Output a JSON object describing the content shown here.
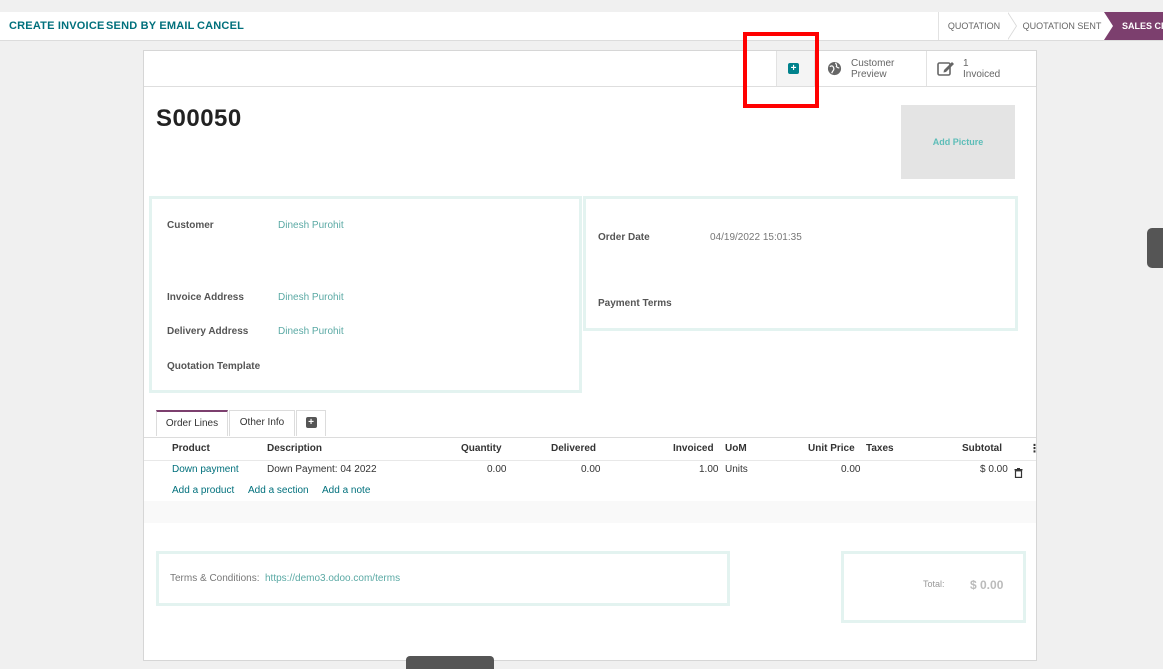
{
  "actions": {
    "create_invoice": "CREATE INVOICE",
    "send_by_email": "SEND BY EMAIL",
    "cancel": "CANCEL"
  },
  "statusbar": {
    "quotation": "QUOTATION",
    "quotation_sent": "QUOTATION SENT",
    "sales_order": "SALES CR"
  },
  "smart_buttons": {
    "customer_preview_line1": "Customer",
    "customer_preview_line2": "Preview",
    "invoiced_count": "1",
    "invoiced_label": "Invoiced"
  },
  "record": {
    "name": "S00050",
    "add_picture": "Add Picture"
  },
  "form_left": {
    "customer_label": "Customer",
    "customer_value": "Dinesh Purohit",
    "invoice_address_label": "Invoice Address",
    "invoice_address_value": "Dinesh Purohit",
    "delivery_address_label": "Delivery Address",
    "delivery_address_value": "Dinesh Purohit",
    "quotation_template_label": "Quotation Template"
  },
  "form_right": {
    "order_date_label": "Order Date",
    "order_date_value": "04/19/2022 15:01:35",
    "payment_terms_label": "Payment Terms"
  },
  "tabs": {
    "order_lines": "Order Lines",
    "other_info": "Other Info"
  },
  "table": {
    "headers": {
      "product": "Product",
      "description": "Description",
      "quantity": "Quantity",
      "delivered": "Delivered",
      "invoiced": "Invoiced",
      "uom": "UoM",
      "unit_price": "Unit Price",
      "taxes": "Taxes",
      "subtotal": "Subtotal"
    },
    "rows": [
      {
        "product": "Down payment",
        "description": "Down Payment: 04 2022",
        "quantity": "0.00",
        "delivered": "0.00",
        "invoiced": "1.00",
        "uom": "Units",
        "unit_price": "0.00",
        "taxes": "",
        "subtotal": "$ 0.00"
      }
    ],
    "add_product": "Add a product",
    "add_section": "Add a section",
    "add_note": "Add a note"
  },
  "footer": {
    "terms_prefix": "Terms & Conditions:",
    "terms_link": "https://demo3.odoo.com/terms",
    "total_label": "Total:",
    "total_value": "$ 0.00"
  },
  "icons": {
    "plus": "+",
    "globe": "globe-icon",
    "edit": "edit-icon",
    "trash": "trash-icon",
    "kebab": "vertical-dots-icon"
  },
  "colors": {
    "accent": "#00707c",
    "link": "#5aa9a4",
    "status_active": "#7c3f6e",
    "group_border": "#e3f3f0",
    "highlight": "#ff0000"
  }
}
